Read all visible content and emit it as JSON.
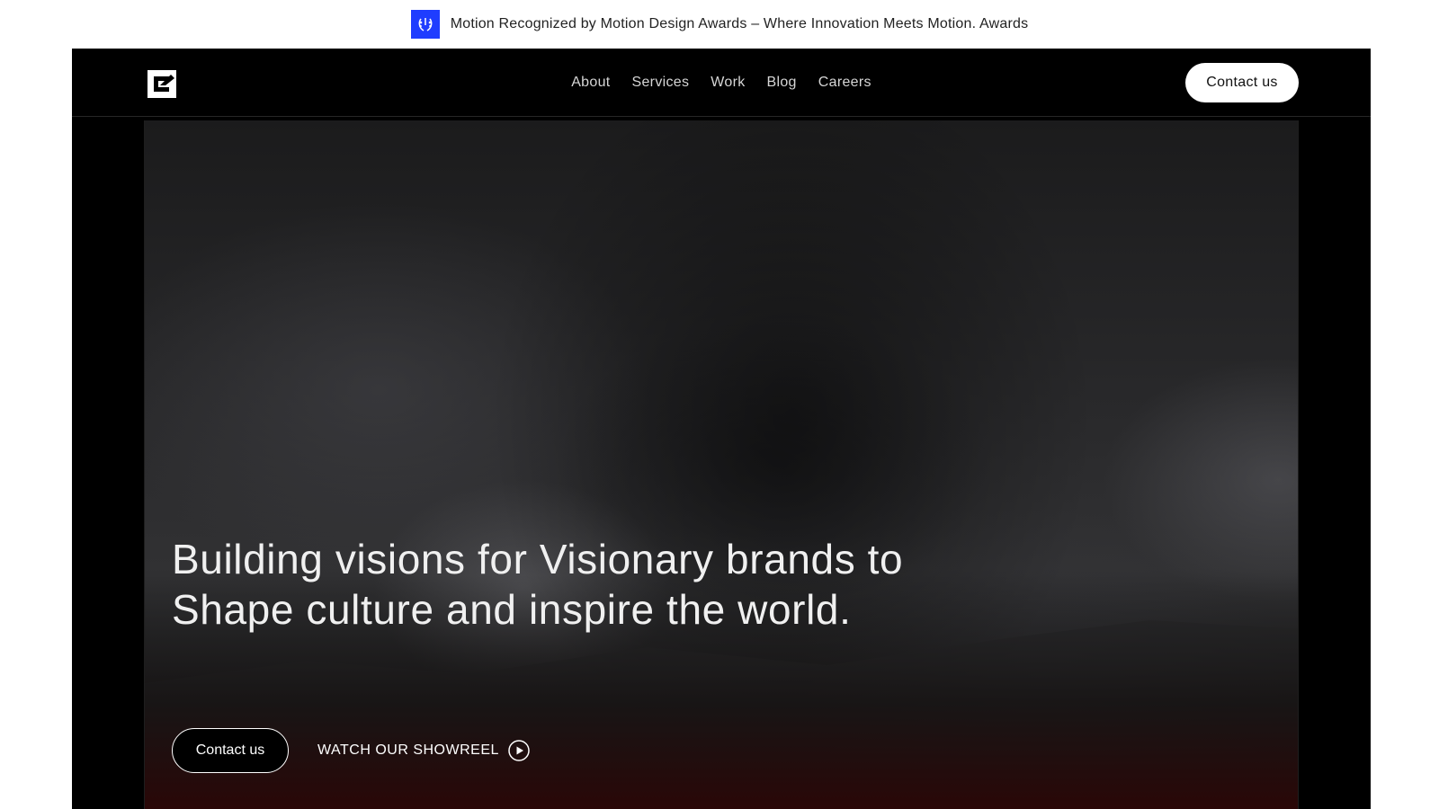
{
  "announcement": {
    "text": "Motion Recognized by Motion Design Awards – Where Innovation Meets Motion.",
    "link_label": "Awards",
    "badge_icon": "laurel-icon"
  },
  "nav": {
    "logo_icon": "brand-logo-icon",
    "links": [
      "About",
      "Services",
      "Work",
      "Blog",
      "Careers"
    ],
    "cta_label": "Contact us"
  },
  "hero": {
    "title": "Building visions for Visionary brands to Shape culture and inspire the world.",
    "primary_button": "Contact us",
    "showreel_label": "WATCH OUR SHOWREEL",
    "showreel_icon": "play-circle-icon"
  },
  "colors": {
    "badge": "#1f3dff",
    "background": "#000000",
    "text_light": "#ffffff",
    "accent_red": "#2a0707"
  }
}
